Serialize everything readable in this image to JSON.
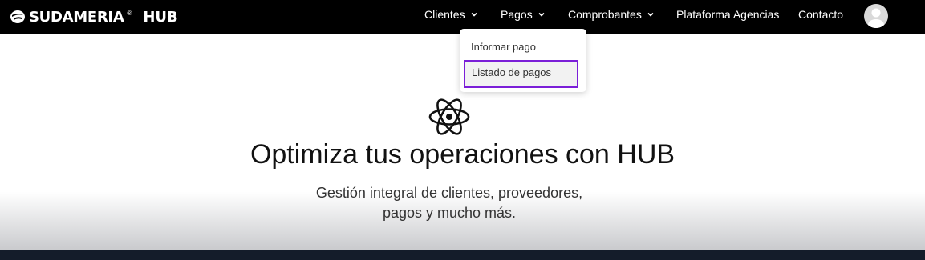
{
  "brand": {
    "name": "SUDAMERIA",
    "mark": "®",
    "product": "HUB"
  },
  "nav": {
    "clientes": "Clientes",
    "pagos": "Pagos",
    "comprobantes": "Comprobantes",
    "agencias": "Plataforma Agencias",
    "contacto": "Contacto"
  },
  "dropdown": {
    "items": [
      "Informar pago",
      "Listado de pagos"
    ],
    "selected": "Listado de pagos",
    "highlight_color": "#7b1fd8"
  },
  "hero": {
    "title": "Optimiza tus operaciones con HUB",
    "subtitle_line1": "Gestión integral de clientes, proveedores,",
    "subtitle_line2": "pagos y mucho más.",
    "icon": "atom-icon"
  },
  "colors": {
    "navbar": "#000000",
    "footer": "#141c2a"
  }
}
